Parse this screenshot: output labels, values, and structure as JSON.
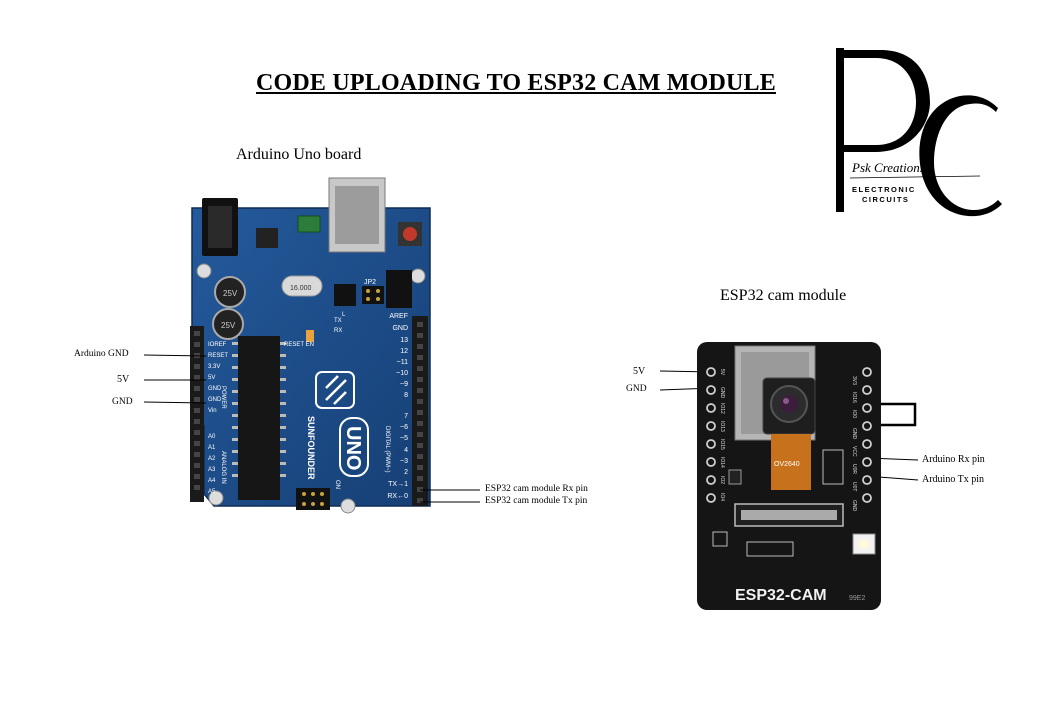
{
  "title": "CODE UPLOADING TO ESP32 CAM MODULE",
  "captions": {
    "uno": "Arduino Uno board",
    "esp": "ESP32 cam module"
  },
  "logo": {
    "letters": "PC",
    "script_name": "Psk Creations",
    "tag_line1": "ELECTRONIC",
    "tag_line2": "CIRCUITS"
  },
  "uno_labels": {
    "gnd_left": "Arduino GND",
    "v5": "5V",
    "gnd2": "GND",
    "rx": "ESP32 cam module Rx pin",
    "tx": "ESP32 cam module Tx pin"
  },
  "esp_labels": {
    "v5": "5V",
    "gnd": "GND",
    "rx": "Arduino Rx pin",
    "tx": "Arduino Tx pin"
  },
  "uno_board": {
    "brand": "SUNFOUNDER",
    "model": "UNO",
    "header_top": [
      "AREF",
      "GND",
      "13",
      "12",
      "~11",
      "~10",
      "~9",
      "8",
      "7",
      "~6",
      "~5",
      "4",
      "~3",
      "2",
      "TX→1",
      "RX←0"
    ],
    "header_left": [
      "IOREF",
      "RESET",
      "3.3V",
      "5V",
      "GND",
      "GND",
      "Vin",
      "A0",
      "A1",
      "A2",
      "A3",
      "A4",
      "A5"
    ],
    "power": "POWER",
    "analog": "ANALOG IN",
    "digital": "DIGITAL (PWM~)",
    "on": "ON",
    "tx_led": "TX",
    "rx_led": "RX",
    "l_led": "L",
    "reset": "RESET EN",
    "jp2": "JP2",
    "crystal": "16.000",
    "cap1": "25V",
    "cap2": "25V"
  },
  "esp_board": {
    "name": "ESP32-CAM",
    "code": "99E2",
    "camera": "OV2640",
    "right_pins": [
      "3V3",
      "IO16",
      "IO0",
      "GND",
      "VCC",
      "U0R",
      "U0T",
      "GND"
    ],
    "left_pins": [
      "5V",
      "GND",
      "IO12",
      "IO13",
      "IO15",
      "IO14",
      "IO2",
      "IO4"
    ]
  },
  "colors": {
    "uno_blue": "#1f4f8c",
    "esp_black": "#151515",
    "header_black": "#1a1a1a"
  }
}
